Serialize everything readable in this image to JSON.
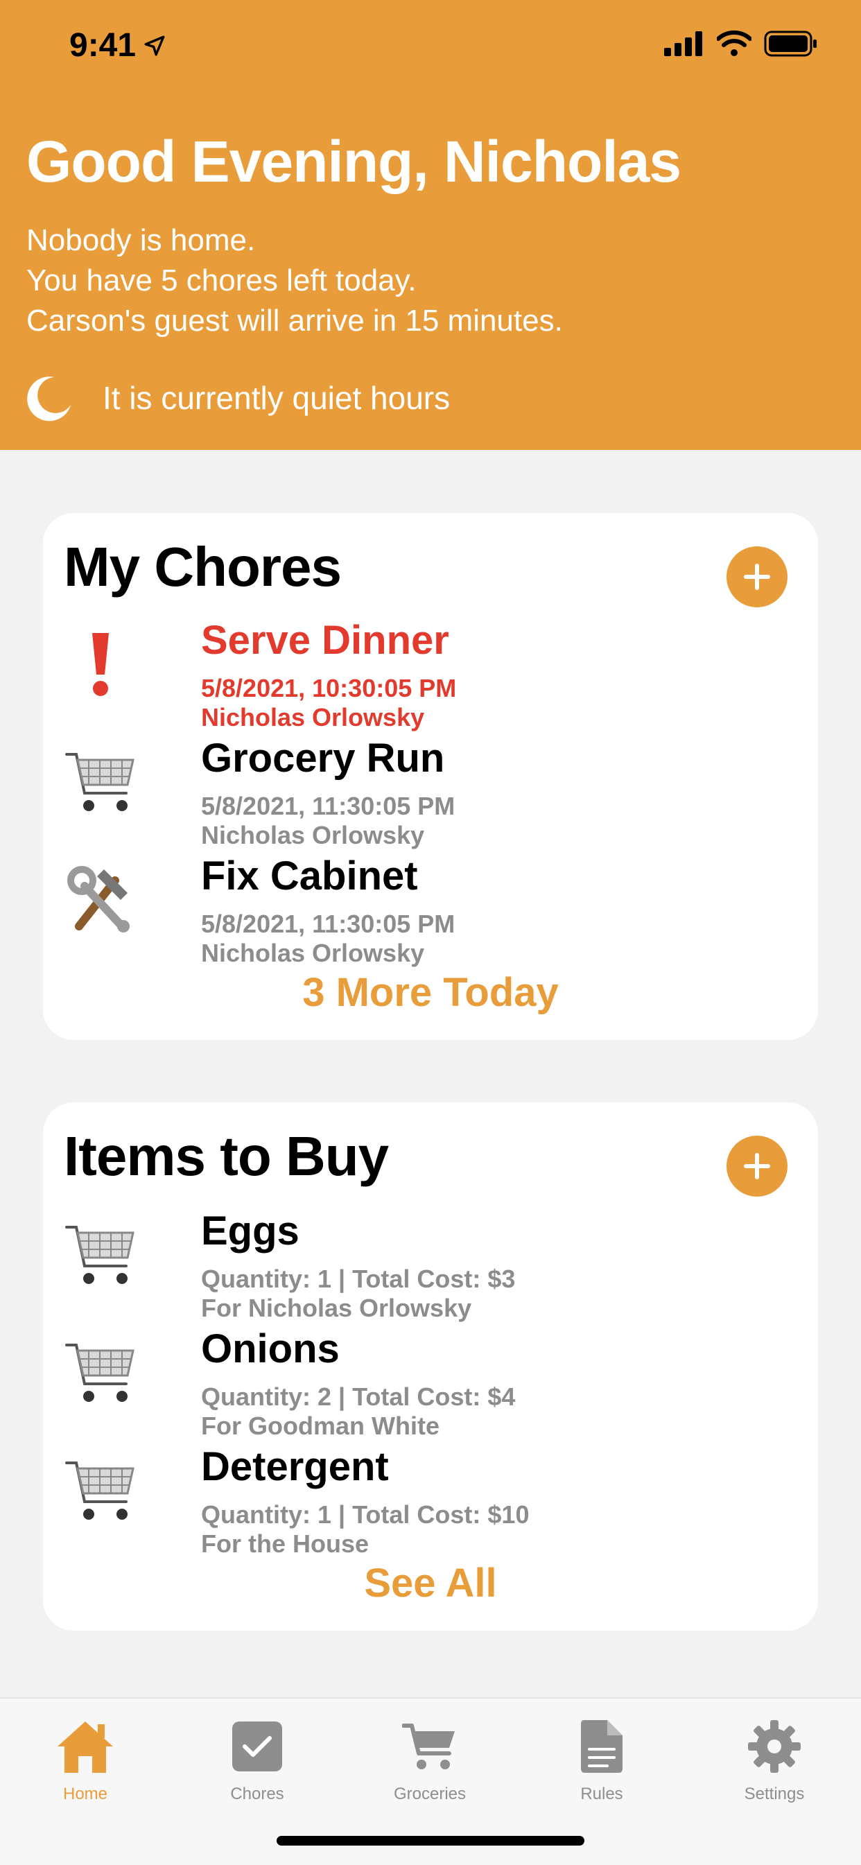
{
  "status_bar": {
    "time": "9:41"
  },
  "header": {
    "greeting": "Good Evening, Nicholas",
    "summary_lines": [
      "Nobody is home.",
      "You have 5 chores left today.",
      "Carson's guest will arrive in 15 minutes."
    ],
    "quiet_hours": "It is currently quiet hours"
  },
  "chores_card": {
    "title": "My Chores",
    "items": [
      {
        "icon": "exclamation-icon",
        "title": "Serve Dinner",
        "date": "5/8/2021, 10:30:05 PM",
        "assignee": "Nicholas Orlowsky",
        "urgent": true
      },
      {
        "icon": "shopping-cart-icon",
        "title": "Grocery Run",
        "date": "5/8/2021, 11:30:05 PM",
        "assignee": "Nicholas Orlowsky",
        "urgent": false
      },
      {
        "icon": "hammer-wrench-icon",
        "title": "Fix Cabinet",
        "date": "5/8/2021, 11:30:05 PM",
        "assignee": "Nicholas Orlowsky",
        "urgent": false
      }
    ],
    "more_label": "3 More Today"
  },
  "items_card": {
    "title": "Items to Buy",
    "items": [
      {
        "icon": "shopping-cart-icon",
        "title": "Eggs",
        "detail": "Quantity: 1 | Total Cost: $3",
        "for": "For Nicholas Orlowsky"
      },
      {
        "icon": "shopping-cart-icon",
        "title": "Onions",
        "detail": "Quantity: 2 | Total Cost: $4",
        "for": "For Goodman White"
      },
      {
        "icon": "shopping-cart-icon",
        "title": "Detergent",
        "detail": "Quantity: 1 | Total Cost: $10",
        "for": "For the House"
      }
    ],
    "see_all_label": "See All"
  },
  "tabbar": {
    "tabs": [
      {
        "label": "Home",
        "icon": "home-icon",
        "active": true
      },
      {
        "label": "Chores",
        "icon": "checkbox-icon",
        "active": false
      },
      {
        "label": "Groceries",
        "icon": "cart-icon",
        "active": false
      },
      {
        "label": "Rules",
        "icon": "document-icon",
        "active": false
      },
      {
        "label": "Settings",
        "icon": "gear-icon",
        "active": false
      }
    ]
  },
  "colors": {
    "accent": "#e89d3a",
    "urgent": "#e23b2e",
    "muted": "#8c8c8c"
  }
}
